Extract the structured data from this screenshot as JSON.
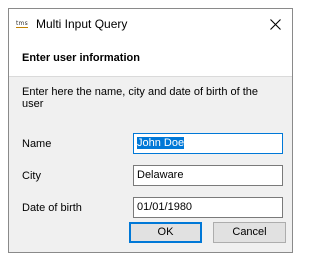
{
  "window": {
    "title": "Multi Input Query",
    "app_icon_text": "tms"
  },
  "header": {
    "title": "Enter user information"
  },
  "description": "Enter here the name, city and date of birth of the user",
  "fields": [
    {
      "label": "Name",
      "value": "John Doe",
      "selected": true
    },
    {
      "label": "City",
      "value": "Delaware"
    },
    {
      "label": "Date of birth",
      "value": "01/01/1980"
    }
  ],
  "buttons": {
    "ok_label": "OK",
    "cancel_label": "Cancel"
  }
}
